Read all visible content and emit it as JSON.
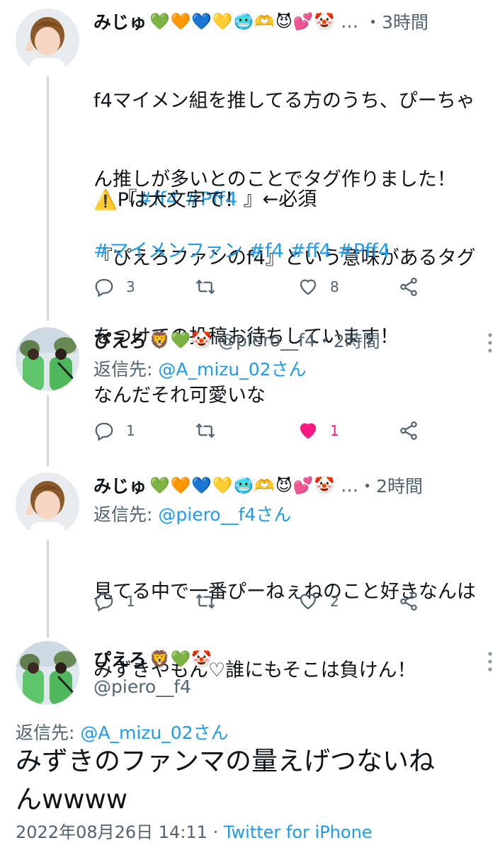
{
  "tweets": [
    {
      "name": "みじゅ",
      "emojis": "💚🧡💙💛🥶🫶😈💕🤡",
      "ellipsis": "…",
      "time": "・3時間",
      "body_lines": [
        "f4マイメン組を推してる方のうち、ぴーちゃ",
        "ん推しが多いとのことでタグ作りました！",
        "『ぴえろファンのf4』という意味があるタグ",
        "をつけての投稿お待ちしています！"
      ],
      "tag_line_prefix": "『",
      "tag_line_tags": "#ff4 #Pff4",
      "tag_line_suffix": " 』←必須",
      "warning_line": "⚠️Pは大文字で！",
      "hashtags": "#マイメンファン #f4 #ff4 #Pff4",
      "replies": "3",
      "likes": "8"
    },
    {
      "name": "ぴえろ",
      "emojis": "🦁💚🤡",
      "handle": "@piero__f4",
      "time": "・2時間",
      "reply_label": "返信先: ",
      "reply_target": "@A_mizu_02さん",
      "body": "なんだそれ可愛いな",
      "replies": "1",
      "likes": "1"
    },
    {
      "name": "みじゅ",
      "emojis": "💚🧡💙💛🥶🫶😈💕🤡",
      "ellipsis": "…",
      "time": "・2時間",
      "reply_label": "返信先: ",
      "reply_target": "@piero__f4さん",
      "body_lines": [
        "見てる中で一番ぴーねぇねのこと好きなんは",
        "みずきやもん♡誰にもそこは負けん！"
      ],
      "replies": "1",
      "likes": "2"
    }
  ],
  "main_tweet": {
    "name": "ぴえろ",
    "emojis": "🦁💚🤡",
    "handle": "@piero__f4",
    "reply_label": "返信先: ",
    "reply_target": "@A_mizu_02さん",
    "body_lines": [
      "みずきのファンマの量えげつないね",
      "んwwww"
    ],
    "timestamp": "2022年08月26日 14:11",
    "separator": " · ",
    "source": "Twitter for iPhone"
  },
  "colors": {
    "link": "#1d9bf0",
    "like_active": "#f91880",
    "secondary_text": "#536471",
    "thread_line": "#cfd9de"
  },
  "icons": [
    "reply-icon",
    "retweet-icon",
    "heart-icon",
    "share-icon",
    "more-icon"
  ]
}
